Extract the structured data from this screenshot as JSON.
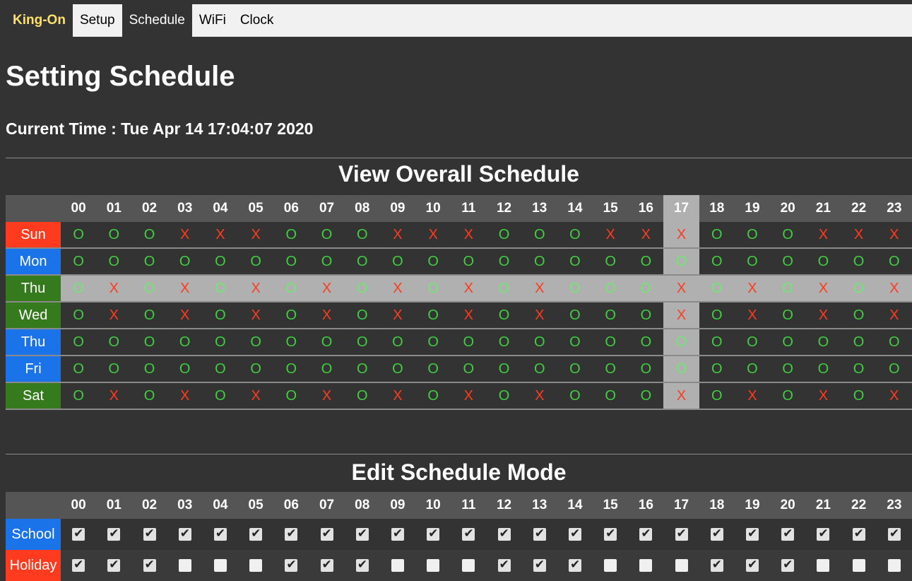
{
  "nav": {
    "brand": "King-On",
    "items": [
      "Setup",
      "Schedule",
      "WiFi",
      "Clock"
    ],
    "active": "Schedule"
  },
  "page_title": "Setting Schedule",
  "current_time": "Current Time : Tue Apr 14 17:04:07 2020",
  "overview": {
    "title": "View Overall Schedule",
    "hours": [
      "00",
      "01",
      "02",
      "03",
      "04",
      "05",
      "06",
      "07",
      "08",
      "09",
      "10",
      "11",
      "12",
      "13",
      "14",
      "15",
      "16",
      "17",
      "18",
      "19",
      "20",
      "21",
      "22",
      "23"
    ],
    "current_hour_index": 17,
    "rows": [
      {
        "day": "Sun",
        "color": "#ff3b1f",
        "cells": [
          "O",
          "O",
          "O",
          "X",
          "X",
          "X",
          "O",
          "O",
          "O",
          "X",
          "X",
          "X",
          "O",
          "O",
          "O",
          "X",
          "X",
          "X",
          "O",
          "O",
          "O",
          "X",
          "X",
          "X"
        ]
      },
      {
        "day": "Mon",
        "color": "#1a73e8",
        "cells": [
          "O",
          "O",
          "O",
          "O",
          "O",
          "O",
          "O",
          "O",
          "O",
          "O",
          "O",
          "O",
          "O",
          "O",
          "O",
          "O",
          "O",
          "O",
          "O",
          "O",
          "O",
          "O",
          "O",
          "O"
        ]
      },
      {
        "day": "Thu",
        "color": "#357a1c",
        "highlight": true,
        "cells": [
          "O",
          "X",
          "O",
          "X",
          "O",
          "X",
          "O",
          "X",
          "O",
          "X",
          "O",
          "X",
          "O",
          "X",
          "O",
          "O",
          "O",
          "X",
          "O",
          "X",
          "O",
          "X",
          "O",
          "X"
        ]
      },
      {
        "day": "Wed",
        "color": "#357a1c",
        "cells": [
          "O",
          "X",
          "O",
          "X",
          "O",
          "X",
          "O",
          "X",
          "O",
          "X",
          "O",
          "X",
          "O",
          "X",
          "O",
          "O",
          "O",
          "X",
          "O",
          "X",
          "O",
          "X",
          "O",
          "X"
        ]
      },
      {
        "day": "Thu",
        "color": "#1a73e8",
        "cells": [
          "O",
          "O",
          "O",
          "O",
          "O",
          "O",
          "O",
          "O",
          "O",
          "O",
          "O",
          "O",
          "O",
          "O",
          "O",
          "O",
          "O",
          "O",
          "O",
          "O",
          "O",
          "O",
          "O",
          "O"
        ]
      },
      {
        "day": "Fri",
        "color": "#1a73e8",
        "cells": [
          "O",
          "O",
          "O",
          "O",
          "O",
          "O",
          "O",
          "O",
          "O",
          "O",
          "O",
          "O",
          "O",
          "O",
          "O",
          "O",
          "O",
          "O",
          "O",
          "O",
          "O",
          "O",
          "O",
          "O"
        ]
      },
      {
        "day": "Sat",
        "color": "#357a1c",
        "cells": [
          "O",
          "X",
          "O",
          "X",
          "O",
          "X",
          "O",
          "X",
          "O",
          "X",
          "O",
          "X",
          "O",
          "X",
          "O",
          "O",
          "O",
          "X",
          "O",
          "X",
          "O",
          "X",
          "O",
          "X"
        ]
      }
    ]
  },
  "edit": {
    "title": "Edit Schedule Mode",
    "hours": [
      "00",
      "01",
      "02",
      "03",
      "04",
      "05",
      "06",
      "07",
      "08",
      "09",
      "10",
      "11",
      "12",
      "13",
      "14",
      "15",
      "16",
      "17",
      "18",
      "19",
      "20",
      "21",
      "22",
      "23"
    ],
    "rows": [
      {
        "mode": "School",
        "color": "#1a73e8",
        "checked": [
          true,
          true,
          true,
          true,
          true,
          true,
          true,
          true,
          true,
          true,
          true,
          true,
          true,
          true,
          true,
          true,
          true,
          true,
          true,
          true,
          true,
          true,
          true,
          true
        ]
      },
      {
        "mode": "Holiday",
        "color": "#ff3b1f",
        "checked": [
          true,
          true,
          true,
          false,
          false,
          false,
          true,
          true,
          true,
          false,
          false,
          false,
          true,
          true,
          true,
          false,
          false,
          false,
          true,
          true,
          true,
          false,
          false,
          false
        ]
      }
    ]
  }
}
